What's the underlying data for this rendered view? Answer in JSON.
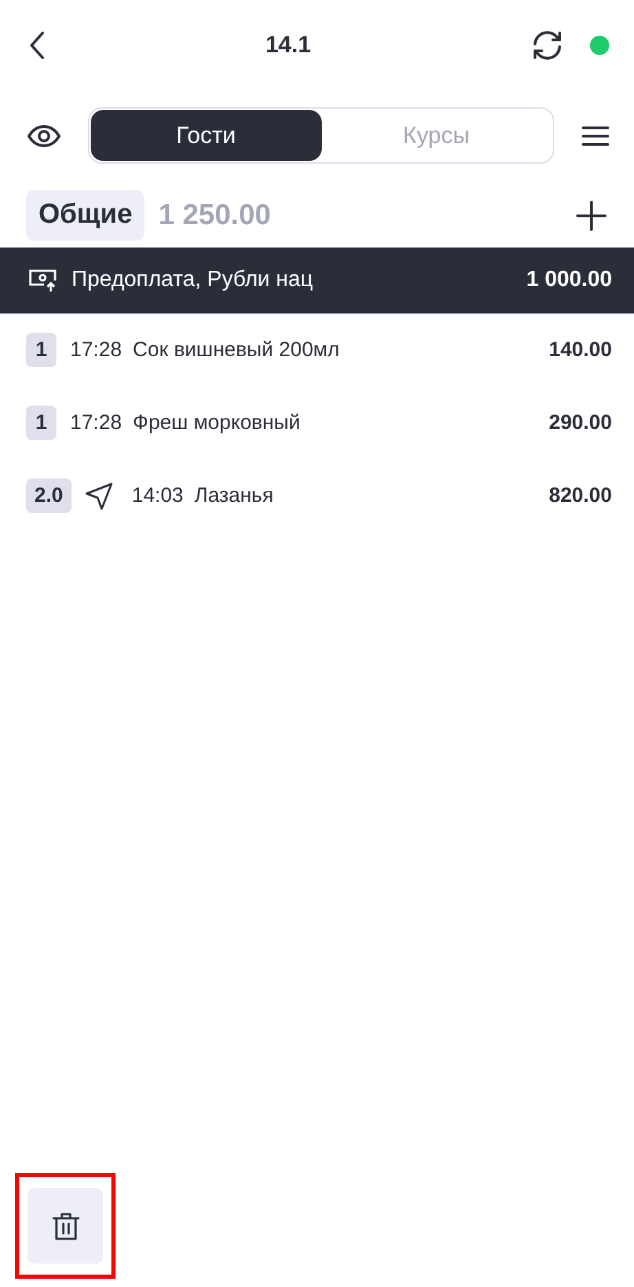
{
  "header": {
    "title": "14.1",
    "online": true
  },
  "tabs": [
    {
      "label": "Гости",
      "selected": true
    },
    {
      "label": "Курсы",
      "selected": false
    }
  ],
  "category": {
    "label": "Общие",
    "total": "1 250.00"
  },
  "prepayment": {
    "label": "Предоплата, Рубли нац",
    "amount": "1 000.00"
  },
  "items": [
    {
      "qty": "1",
      "sent": false,
      "time": "17:28",
      "name": "Сок вишневый 200мл",
      "price": "140.00"
    },
    {
      "qty": "1",
      "sent": false,
      "time": "17:28",
      "name": "Фреш морковный",
      "price": "290.00"
    },
    {
      "qty": "2.0",
      "sent": true,
      "time": "14:03",
      "name": "Лазанья",
      "price": "820.00"
    }
  ],
  "delete_button": {
    "highlighted": true
  }
}
